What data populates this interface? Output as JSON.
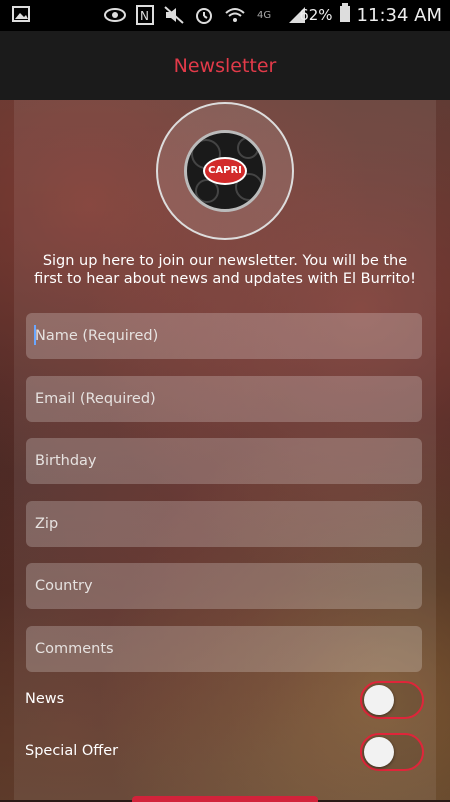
{
  "status_bar": {
    "battery_percent": "62%",
    "time": "11:34 AM",
    "icons": [
      "image-icon",
      "eye-icon",
      "nfc-icon",
      "mute-icon",
      "alarm-icon",
      "wifi-icon",
      "4g-icon",
      "signal-icon",
      "battery-icon"
    ]
  },
  "header": {
    "title": "Newsletter"
  },
  "logo": {
    "text": "CAPRI"
  },
  "intro_text": "Sign up here to join our newsletter. You will be the first to hear about news and updates with El Burrito!",
  "form": {
    "name_placeholder": "Name (Required)",
    "email_placeholder": "Email (Required)",
    "birthday_placeholder": "Birthday",
    "zip_placeholder": "Zip",
    "country_placeholder": "Country",
    "comments_placeholder": "Comments"
  },
  "toggles": {
    "news_label": "News",
    "special_offer_label": "Special Offer"
  },
  "colors": {
    "accent": "#e23a49",
    "toggle_border": "#e0253a"
  }
}
